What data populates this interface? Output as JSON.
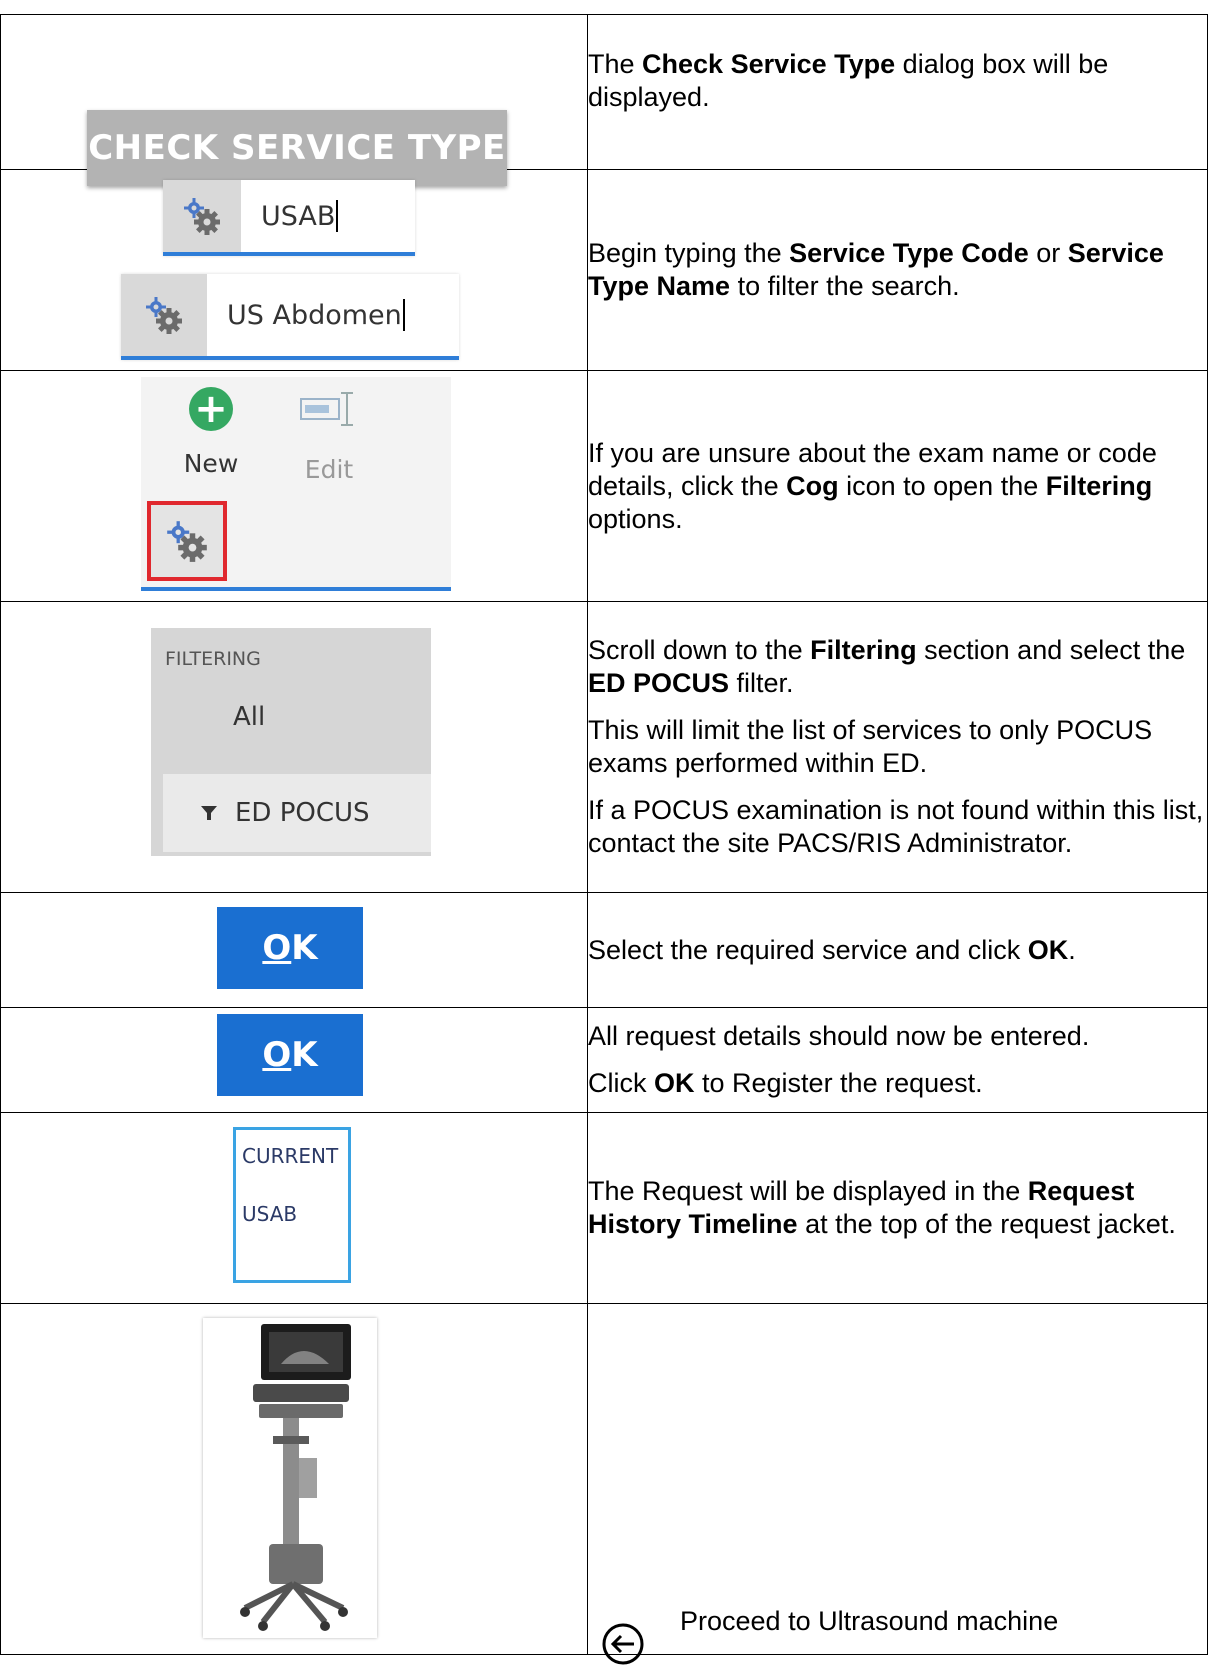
{
  "rows": [
    {
      "button_label": "CHECK SERVICE TYPE",
      "text_pre": "The ",
      "text_bold": "Check Service Type",
      "text_post": " dialog box will be displayed."
    },
    {
      "search_value_1": "USAB",
      "search_value_2": "US Abdomen",
      "text_pre": "Begin typing the ",
      "text_bold_1": "Service Type Code",
      "text_mid": " or ",
      "text_bold_2": "Service Type Name",
      "text_post": " to filter the search."
    },
    {
      "new_label": "New",
      "edit_label": "Edit",
      "text_pre": "If you are unsure about the exam name or code details, click the ",
      "text_bold_1": "Cog",
      "text_mid": " icon to open the ",
      "text_bold_2": "Filtering",
      "text_post": " options."
    },
    {
      "filter_heading": "FILTERING",
      "filter_all": "All",
      "filter_selected": "ED POCUS",
      "p1_pre": "Scroll down to the ",
      "p1_bold_1": "Filtering",
      "p1_mid": " section and select the ",
      "p1_bold_2": "ED POCUS",
      "p1_post": " filter.",
      "p2": "This will limit the list of services to only POCUS exams performed within ED.",
      "p3": "If a POCUS examination is not found within this list, contact the site PACS/RIS Administrator."
    },
    {
      "ok_underlined": "O",
      "ok_rest": "K",
      "text_pre": "Select the required service and click ",
      "text_bold": "OK",
      "text_post": "."
    },
    {
      "ok_underlined": "O",
      "ok_rest": "K",
      "p1": "All request details should now be entered.",
      "p2_pre": "Click ",
      "p2_bold": "OK",
      "p2_post": " to Register the request."
    },
    {
      "timeline_status": "CURRENT",
      "timeline_code": "USAB",
      "text_pre": "The Request will be displayed in the ",
      "text_bold": "Request History Timeline",
      "text_post": " at the top of the request jacket."
    },
    {
      "proceed_text": "Proceed to Ultrasound machine"
    }
  ],
  "colors": {
    "accent_blue": "#2f7ed8",
    "ok_button": "#1a6fd1",
    "highlight_red": "#e0282e",
    "new_green": "#35a862",
    "timeline_border": "#3aa3e3"
  }
}
